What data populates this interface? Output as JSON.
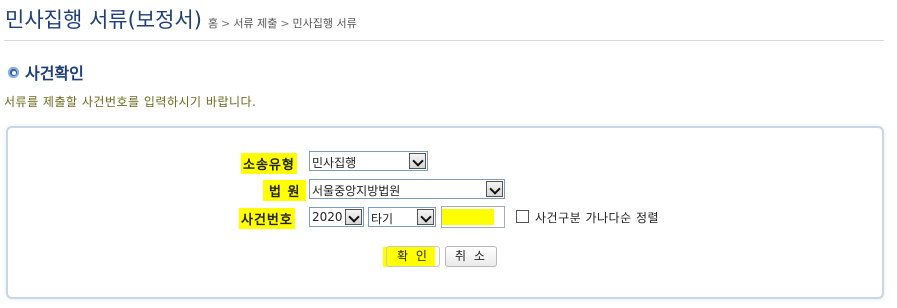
{
  "header": {
    "title": "민사집행 서류(보정서)",
    "breadcrumb": [
      "홈",
      "서류 제출",
      "민사집행 서류"
    ],
    "breadcrumb_separator": ">"
  },
  "section": {
    "title": "사건확인",
    "instruction": "서류를 제출할 사건번호를 입력하시기 바랍니다."
  },
  "form": {
    "lawsuit_type": {
      "label": "소송유형",
      "value": "민사집행"
    },
    "court": {
      "label": "법 원",
      "value": "서울중앙지방법원"
    },
    "case_number": {
      "label": "사건번호",
      "year": "2020",
      "type": "타기",
      "number": ""
    },
    "sort_checkbox": {
      "label": "사건구분 가나다순 정렬",
      "checked": false
    }
  },
  "buttons": {
    "confirm": "확 인",
    "cancel": "취 소"
  },
  "colors": {
    "title": "#1f3f7a",
    "instruction": "#6b6b1e",
    "highlight": "#ffff00",
    "panel_border": "#c9d6e6"
  },
  "icons": {
    "section_bullet": "circle-bullet-icon",
    "dropdown": "chevron-down-icon"
  }
}
